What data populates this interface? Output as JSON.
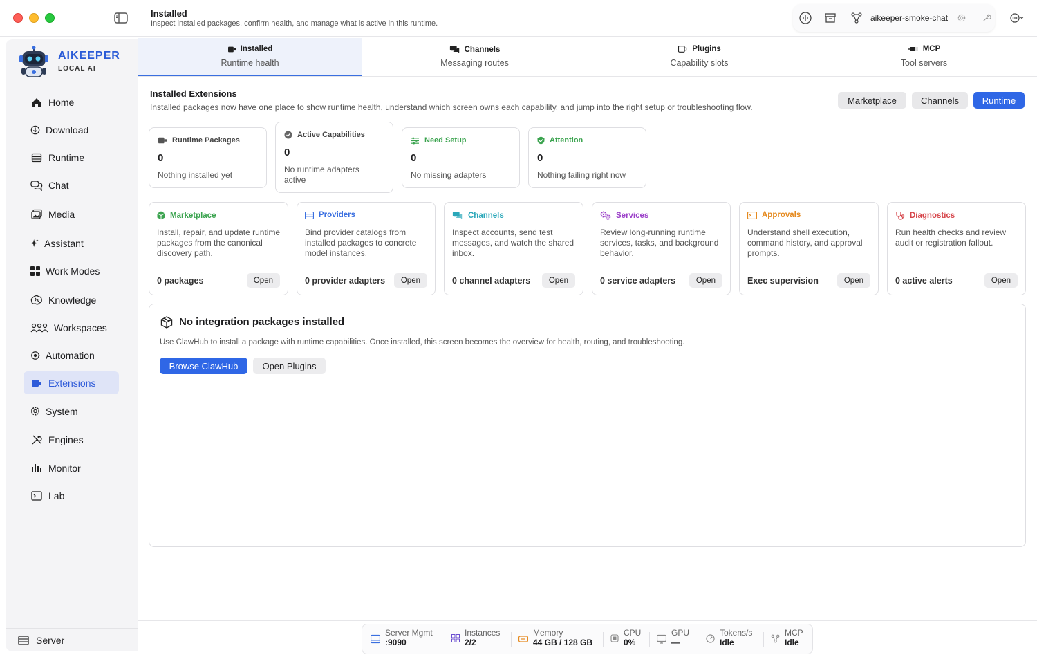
{
  "window": {
    "title": "Installed",
    "subtitle": "Inspect installed packages, confirm health, and manage what is active in this runtime."
  },
  "toolbar": {
    "workspace_label": "aikeeper-smoke-chat",
    "icons": [
      "waveform-icon",
      "archive-icon",
      "branch-icon",
      "gear-icon",
      "wrench-icon",
      "more-icon"
    ]
  },
  "brand": {
    "name": "AIKEEPER",
    "tagline": "LOCAL AI"
  },
  "sidebar": {
    "items": [
      {
        "id": "home",
        "label": "Home",
        "icon": "home-icon"
      },
      {
        "id": "download",
        "label": "Download",
        "icon": "download-icon"
      },
      {
        "id": "runtime",
        "label": "Runtime",
        "icon": "runtime-icon"
      },
      {
        "id": "chat",
        "label": "Chat",
        "icon": "chat-icon"
      },
      {
        "id": "media",
        "label": "Media",
        "icon": "media-icon"
      },
      {
        "id": "assistant",
        "label": "Assistant",
        "icon": "sparkle-icon"
      },
      {
        "id": "work-modes",
        "label": "Work Modes",
        "icon": "grid-icon"
      },
      {
        "id": "knowledge",
        "label": "Knowledge",
        "icon": "brain-icon"
      },
      {
        "id": "workspaces",
        "label": "Workspaces",
        "icon": "people-icon"
      },
      {
        "id": "automation",
        "label": "Automation",
        "icon": "automation-icon"
      },
      {
        "id": "extensions",
        "label": "Extensions",
        "icon": "plugin-icon",
        "active": true
      },
      {
        "id": "system",
        "label": "System",
        "icon": "gear-icon"
      },
      {
        "id": "engines",
        "label": "Engines",
        "icon": "tools-icon"
      },
      {
        "id": "monitor",
        "label": "Monitor",
        "icon": "bars-icon"
      },
      {
        "id": "lab",
        "label": "Lab",
        "icon": "terminal-icon"
      }
    ],
    "footer": {
      "label": "Server",
      "icon": "server-icon"
    }
  },
  "tabs": [
    {
      "title": "Installed",
      "subtitle": "Runtime health",
      "active": true
    },
    {
      "title": "Channels",
      "subtitle": "Messaging routes"
    },
    {
      "title": "Plugins",
      "subtitle": "Capability slots"
    },
    {
      "title": "MCP",
      "subtitle": "Tool servers"
    }
  ],
  "section": {
    "title": "Installed Extensions",
    "description": "Installed packages now have one place to show runtime health, understand which screen owns each capability, and jump into the right setup or troubleshooting flow.",
    "buttons": [
      "Marketplace",
      "Channels",
      "Runtime"
    ]
  },
  "stats": [
    {
      "label": "Runtime Packages",
      "value": "0",
      "note": "Nothing installed yet",
      "color": "#444444"
    },
    {
      "label": "Active Capabilities",
      "value": "0",
      "note": "No runtime adapters active",
      "color": "#444444"
    },
    {
      "label": "Need Setup",
      "value": "0",
      "note": "No missing adapters",
      "color": "#3aa34e"
    },
    {
      "label": "Attention",
      "value": "0",
      "note": "Nothing failing right now",
      "color": "#3aa34e"
    }
  ],
  "features": [
    {
      "title": "Marketplace",
      "desc": "Install, repair, and update runtime packages from the canonical discovery path.",
      "count": "0 packages",
      "action": "Open",
      "color": "#3aa34e"
    },
    {
      "title": "Providers",
      "desc": "Bind provider catalogs from installed packages to concrete model instances.",
      "count": "0 provider adapters",
      "action": "Open",
      "color": "#3a6fe0"
    },
    {
      "title": "Channels",
      "desc": "Inspect accounts, send test messages, and watch the shared inbox.",
      "count": "0 channel adapters",
      "action": "Open",
      "color": "#2aa7b9"
    },
    {
      "title": "Services",
      "desc": "Review long-running runtime services, tasks, and background behavior.",
      "count": "0 service adapters",
      "action": "Open",
      "color": "#9b3fc9"
    },
    {
      "title": "Approvals",
      "desc": "Understand shell execution, command history, and approval prompts.",
      "count": "Exec supervision",
      "action": "Open",
      "color": "#e58a1f"
    },
    {
      "title": "Diagnostics",
      "desc": "Run health checks and review audit or registration fallout.",
      "count": "0 active alerts",
      "action": "Open",
      "color": "#d6454a"
    }
  ],
  "empty": {
    "title": "No integration packages installed",
    "description": "Use ClawHub to install a package with runtime capabilities. Once installed, this screen becomes the overview for health, routing, and troubleshooting.",
    "primary": "Browse ClawHub",
    "secondary": "Open Plugins"
  },
  "status": [
    {
      "label": "Server Mgmt",
      "value": ":9090",
      "icon": "server-icon",
      "color": "#3a6fe0"
    },
    {
      "label": "Instances",
      "value": "2/2",
      "icon": "instances-icon",
      "color": "#6b4fd0"
    },
    {
      "label": "Memory",
      "value": "44 GB / 128 GB",
      "icon": "memory-icon",
      "color": "#e58a1f"
    },
    {
      "label": "CPU",
      "value": "0%",
      "icon": "cpu-icon",
      "color": "#888888"
    },
    {
      "label": "GPU",
      "value": "—",
      "icon": "gpu-icon",
      "color": "#888888"
    },
    {
      "label": "Tokens/s",
      "value": "Idle",
      "icon": "gauge-icon",
      "color": "#888888"
    },
    {
      "label": "MCP",
      "value": "Idle",
      "icon": "mcp-icon",
      "color": "#888888"
    }
  ]
}
